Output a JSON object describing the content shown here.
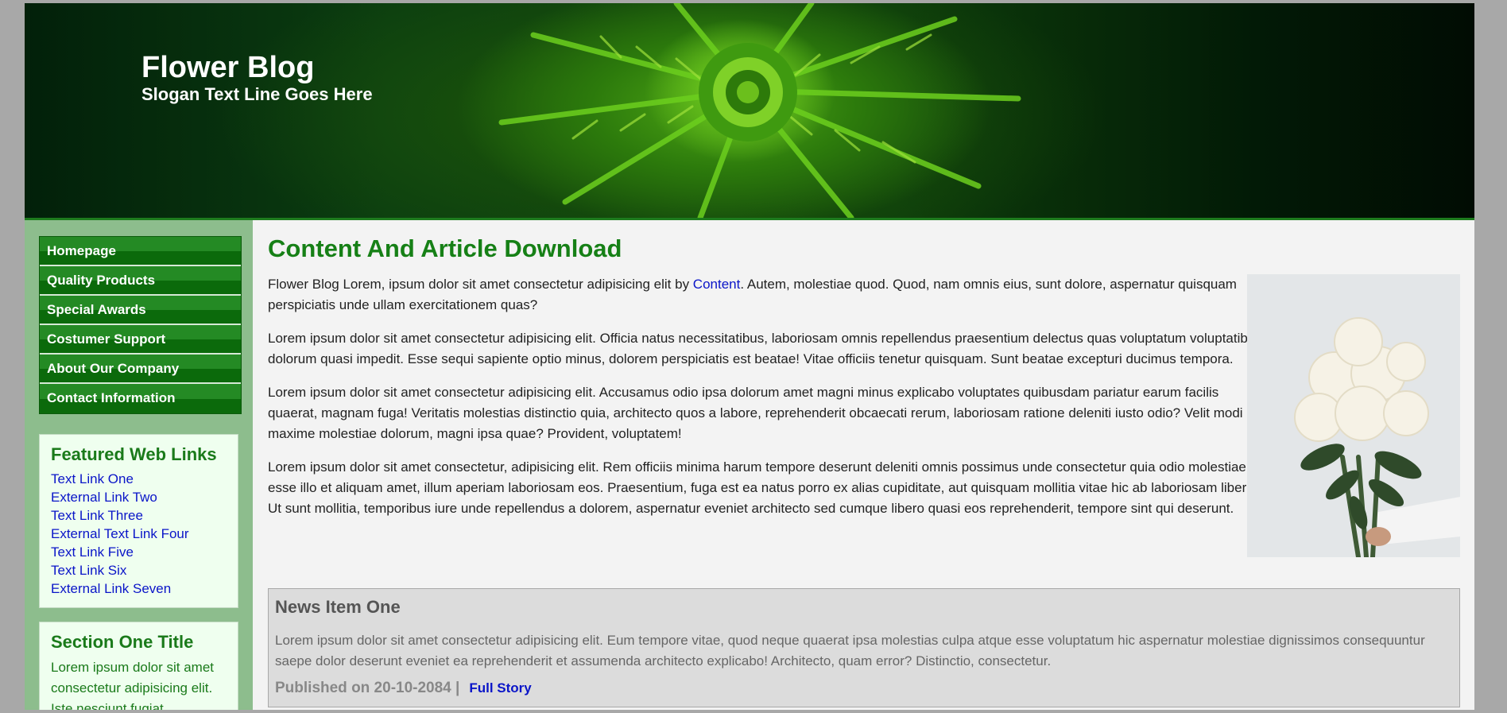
{
  "header": {
    "title": "Flower Blog",
    "slogan": "Slogan Text Line Goes Here"
  },
  "nav": {
    "items": [
      {
        "label": "Homepage"
      },
      {
        "label": "Quality Products"
      },
      {
        "label": "Special Awards"
      },
      {
        "label": "Costumer Support"
      },
      {
        "label": "About Our Company"
      },
      {
        "label": "Contact Information"
      }
    ]
  },
  "featured": {
    "title": "Featured Web Links",
    "links": [
      "Text Link One",
      "External Link Two",
      "Text Link Three",
      "External Text Link Four",
      "Text Link Five",
      "Text Link Six",
      "External Link Seven"
    ]
  },
  "section_one": {
    "title": "Section One Title",
    "text": "Lorem ipsum dolor sit amet consectetur adipisicing elit. Iste nesciunt fugiat"
  },
  "main": {
    "heading": "Content And Article Download",
    "p1_before": "Flower Blog Lorem, ipsum dolor sit amet consectetur adipisicing elit by ",
    "p1_link": "Content",
    "p1_after": ". Autem, molestiae quod. Quod, nam omnis eius, sunt dolore, aspernatur quisquam perspiciatis unde ullam exercitationem quas?",
    "p2": "Lorem ipsum dolor sit amet consectetur adipisicing elit. Officia natus necessitatibus, laboriosam omnis repellendus praesentium delectus quas voluptatum voluptatibus dolorum quasi impedit. Esse sequi sapiente optio minus, dolorem perspiciatis est beatae! Vitae officiis tenetur quisquam. Sunt beatae excepturi ducimus tempora.",
    "p3": "Lorem ipsum dolor sit amet consectetur adipisicing elit. Accusamus odio ipsa dolorum amet magni minus explicabo voluptates quibusdam pariatur earum facilis quaerat, magnam fuga! Veritatis molestias distinctio quia, architecto quos a labore, reprehenderit obcaecati rerum, laboriosam ratione deleniti iusto odio? Velit modi maxime molestiae dolorum, magni ipsa quae? Provident, voluptatem!",
    "p4": "Lorem ipsum dolor sit amet consectetur, adipisicing elit. Rem officiis minima harum tempore deserunt deleniti omnis possimus unde consectetur quia odio molestiae, esse illo et aliquam amet, illum aperiam laboriosam eos. Praesentium, fuga est ea natus porro ex alias cupiditate, aut quisquam mollitia vitae hic ab laboriosam libero? Ut sunt mollitia, temporibus iure unde repellendus a dolorem, aspernatur eveniet architecto sed cumque libero quasi eos reprehenderit, tempore sint qui deserunt."
  },
  "news": {
    "title": "News Item One",
    "text": "Lorem ipsum dolor sit amet consectetur adipisicing elit. Eum tempore vitae, quod neque quaerat ipsa molestias culpa atque esse voluptatum hic aspernatur molestiae dignissimos consequuntur saepe dolor deserunt eveniet ea reprehenderit et assumenda architecto explicabo! Architecto, quam error? Distinctio, consectetur.",
    "published": "Published on 20-10-2084 |",
    "full_story": "Full Story"
  },
  "colors": {
    "accent_green": "#168016",
    "link_blue": "#0a15c8",
    "nav_green": "#248a24"
  }
}
